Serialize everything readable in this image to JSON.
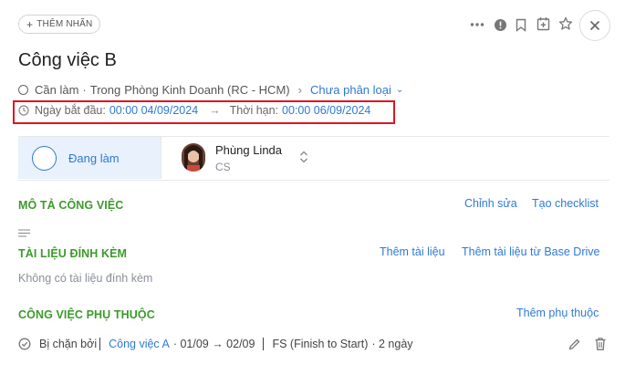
{
  "top_bar": {
    "add_tag_label": "THÊM NHÃN",
    "icons": [
      "more-icon",
      "info-icon",
      "bookmark-icon",
      "calendar-add-icon",
      "star-icon",
      "close-icon"
    ]
  },
  "task": {
    "title": "Công việc B",
    "status": "Cần làm",
    "location_prefix": "Trong",
    "location": "Phòng Kinh Doanh (RC - HCM)",
    "category": "Chưa phân loại",
    "start_label": "Ngày bắt đầu:",
    "start_value": "00:00 04/09/2024",
    "due_label": "Thời hạn:",
    "due_value": "00:00 06/09/2024"
  },
  "state": {
    "label": "Đang làm"
  },
  "assignee": {
    "name": "Phùng Linda",
    "role": "CS"
  },
  "sections": {
    "description": {
      "title": "MÔ TẢ CÔNG VIỆC",
      "edit_label": "Chỉnh sửa",
      "checklist_label": "Tạo checklist"
    },
    "attachments": {
      "title": "TÀI LIỆU ĐÍNH KÈM",
      "add_label": "Thêm tài liệu",
      "add_drive_label": "Thêm tài liệu từ Base Drive",
      "empty_text": "Không có tài liệu đính kèm"
    },
    "dependencies": {
      "title": "CÔNG VIỆC PHỤ THUỘC",
      "add_label": "Thêm phụ thuộc",
      "items": [
        {
          "relation": "Bị chặn bởi",
          "task": "Công việc A",
          "range": "· 01/09 → 02/09",
          "type": "FS (Finish to Start)",
          "duration": "· 2 ngày"
        }
      ]
    }
  },
  "colors": {
    "accent_blue": "#2f7ad3",
    "section_green": "#3c9a2c",
    "highlight_red": "#e0141e",
    "state_bg": "#e8f1fc"
  }
}
